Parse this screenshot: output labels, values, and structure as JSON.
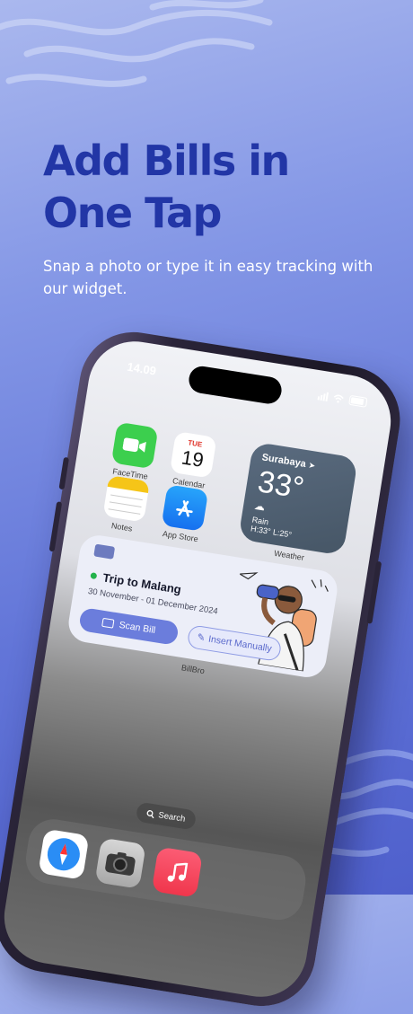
{
  "headline": "Add Bills in One Tap",
  "subtitle": "Snap a photo or type it in easy tracking with our widget.",
  "phone": {
    "status_time": "14.09",
    "apps": [
      {
        "label": "FaceTime",
        "icon": "facetime-icon",
        "color": "#3ccf4e"
      },
      {
        "label": "Calendar",
        "icon": "calendar-icon",
        "day": "TUE",
        "date": "19"
      },
      {
        "label": "Notes",
        "icon": "notes-icon",
        "color": "#f5c518"
      },
      {
        "label": "App Store",
        "icon": "app-store-icon",
        "color": "#1e88f5"
      }
    ],
    "weather": {
      "city": "Surabaya",
      "temp": "33°",
      "condition": "Rain",
      "range": "H:33° L:25°",
      "label": "Weather"
    },
    "widget": {
      "trip_title": "Trip to Malang",
      "trip_dates": "30 November - 01 December 2024",
      "scan_label": "Scan Bill",
      "manual_label": "Insert Manually",
      "label": "BillBro"
    },
    "search_label": "Search",
    "dock": [
      {
        "icon": "safari-icon"
      },
      {
        "icon": "camera-icon"
      },
      {
        "icon": "music-icon"
      }
    ]
  },
  "colors": {
    "headline": "#2236a6",
    "accent": "#6b7ddc",
    "background_top": "#aab8ee",
    "background_bottom": "#4f60cc"
  }
}
